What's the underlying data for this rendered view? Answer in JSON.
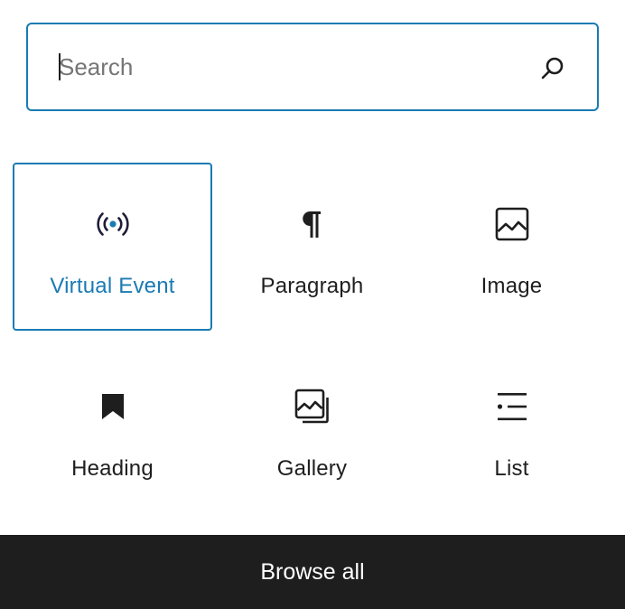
{
  "search": {
    "placeholder": "Search",
    "value": ""
  },
  "blocks": [
    {
      "label": "Virtual Event",
      "icon": "broadcast-icon",
      "selected": true
    },
    {
      "label": "Paragraph",
      "icon": "pilcrow-icon",
      "selected": false
    },
    {
      "label": "Image",
      "icon": "image-icon",
      "selected": false
    },
    {
      "label": "Heading",
      "icon": "bookmark-icon",
      "selected": false
    },
    {
      "label": "Gallery",
      "icon": "gallery-icon",
      "selected": false
    },
    {
      "label": "List",
      "icon": "list-icon",
      "selected": false
    }
  ],
  "footer": {
    "browse_all_label": "Browse all"
  },
  "colors": {
    "accent": "#1a7bb3",
    "text": "#1e1e1e",
    "footer_bg": "#1e1e1e",
    "placeholder": "#757575"
  }
}
